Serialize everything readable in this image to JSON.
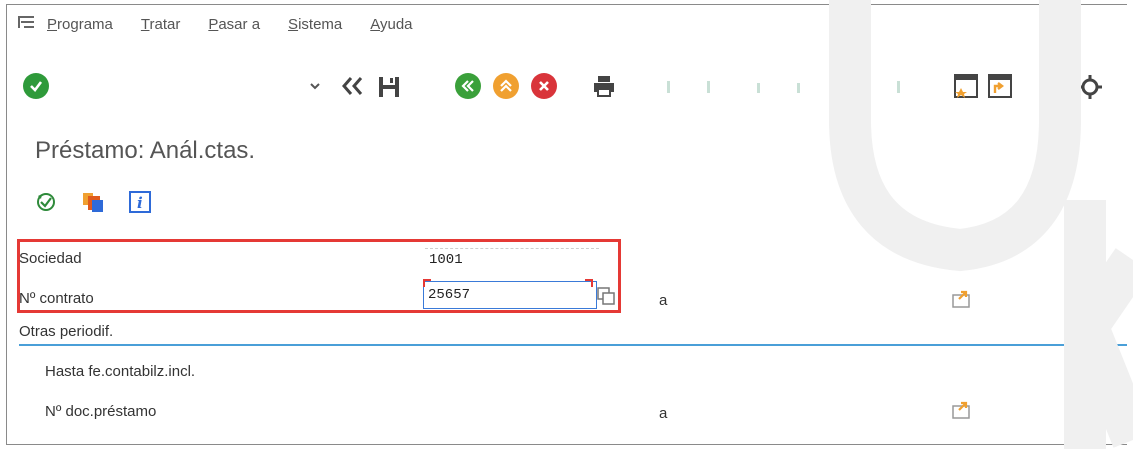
{
  "menu": {
    "items": [
      "Programa",
      "Tratar",
      "Pasar a",
      "Sistema",
      "Ayuda"
    ]
  },
  "page": {
    "title": "Préstamo: Anál.ctas."
  },
  "form": {
    "sociedad_label": "Sociedad",
    "sociedad_value": "1001",
    "contrato_label": "Nº contrato",
    "contrato_value": "25657",
    "contrato_to_label": "a",
    "section_label": "Otras periodif.",
    "hasta_label": "Hasta fe.contabilz.incl.",
    "doc_label": "Nº doc.préstamo",
    "doc_to_label": "a"
  },
  "colors": {
    "accept_green": "#3a9a3a",
    "nav_green": "#3aa03a",
    "exit_orange": "#f0a030",
    "cancel_red": "#d9343a",
    "help_orange": "#f29a1c",
    "highlight_red": "#e53935",
    "section_rule_blue": "#4a9fd8"
  },
  "icons": {
    "menu": "menu-icon",
    "enter": "check-icon",
    "back": "double-chevron-left-icon",
    "save": "save-icon",
    "nav_back": "back-icon",
    "exit": "exit-icon",
    "cancel": "cancel-icon",
    "print": "print-icon",
    "help": "help-icon"
  }
}
